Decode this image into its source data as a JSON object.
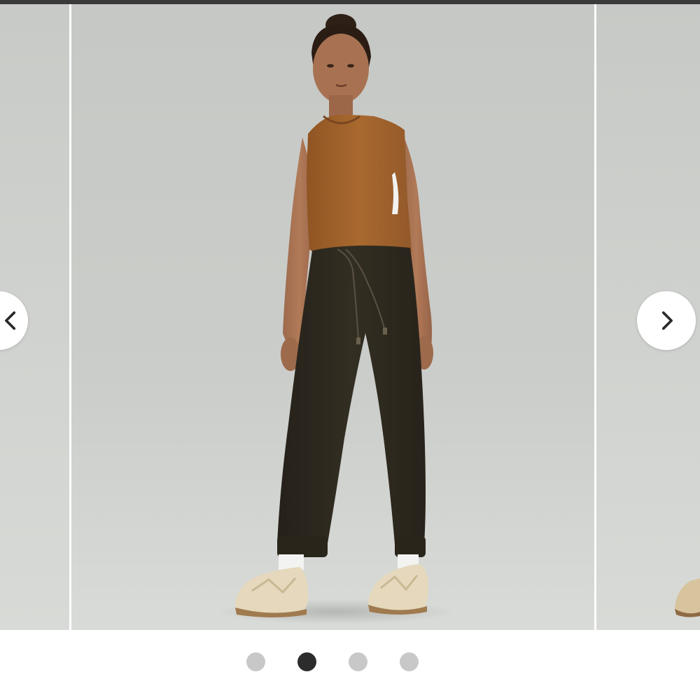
{
  "carousel": {
    "slides": [
      {
        "label": "model-side-view"
      },
      {
        "label": "model-front-view"
      },
      {
        "label": "model-walking-view"
      }
    ],
    "active_index": 1,
    "slide_count": 4
  },
  "navigation": {
    "prev_icon": "chevron-left-icon",
    "next_icon": "chevron-right-icon"
  },
  "colors": {
    "top_bar": "#3a3a3a",
    "backdrop": "#cdcfcc",
    "dot_active": "#2c2c2c",
    "dot_inactive": "#c8c8c8",
    "tank_top": "#a0632a",
    "joggers": "#2f2a1d",
    "sneakers": "#e6d9bd"
  }
}
